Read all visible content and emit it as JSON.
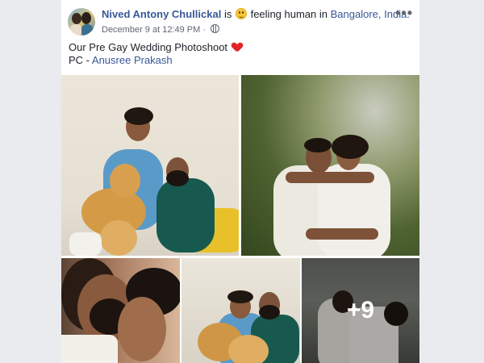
{
  "post": {
    "author_name": "Nived Antony Chullickal",
    "is_text": "is",
    "feeling_text": "feeling human in",
    "location": "Bangalore, India.",
    "timestamp": "December 9 at 12:49 PM",
    "timestamp_separator": "·",
    "more_label": "•••",
    "caption_line1": "Our Pre Gay Wedding Photoshoot",
    "credit_prefix": "PC -",
    "credit_name": "Anusree Prakash",
    "more_photos_label": "+9"
  },
  "icons": {
    "feeling": "smiley-emoji-icon",
    "heart": "red-heart-icon",
    "privacy": "globe-icon",
    "options": "more-options-icon"
  },
  "colors": {
    "link": "#385898",
    "text": "#1d2129",
    "meta": "#606770",
    "background": "#e9ebee",
    "heart": "#e0242a"
  }
}
